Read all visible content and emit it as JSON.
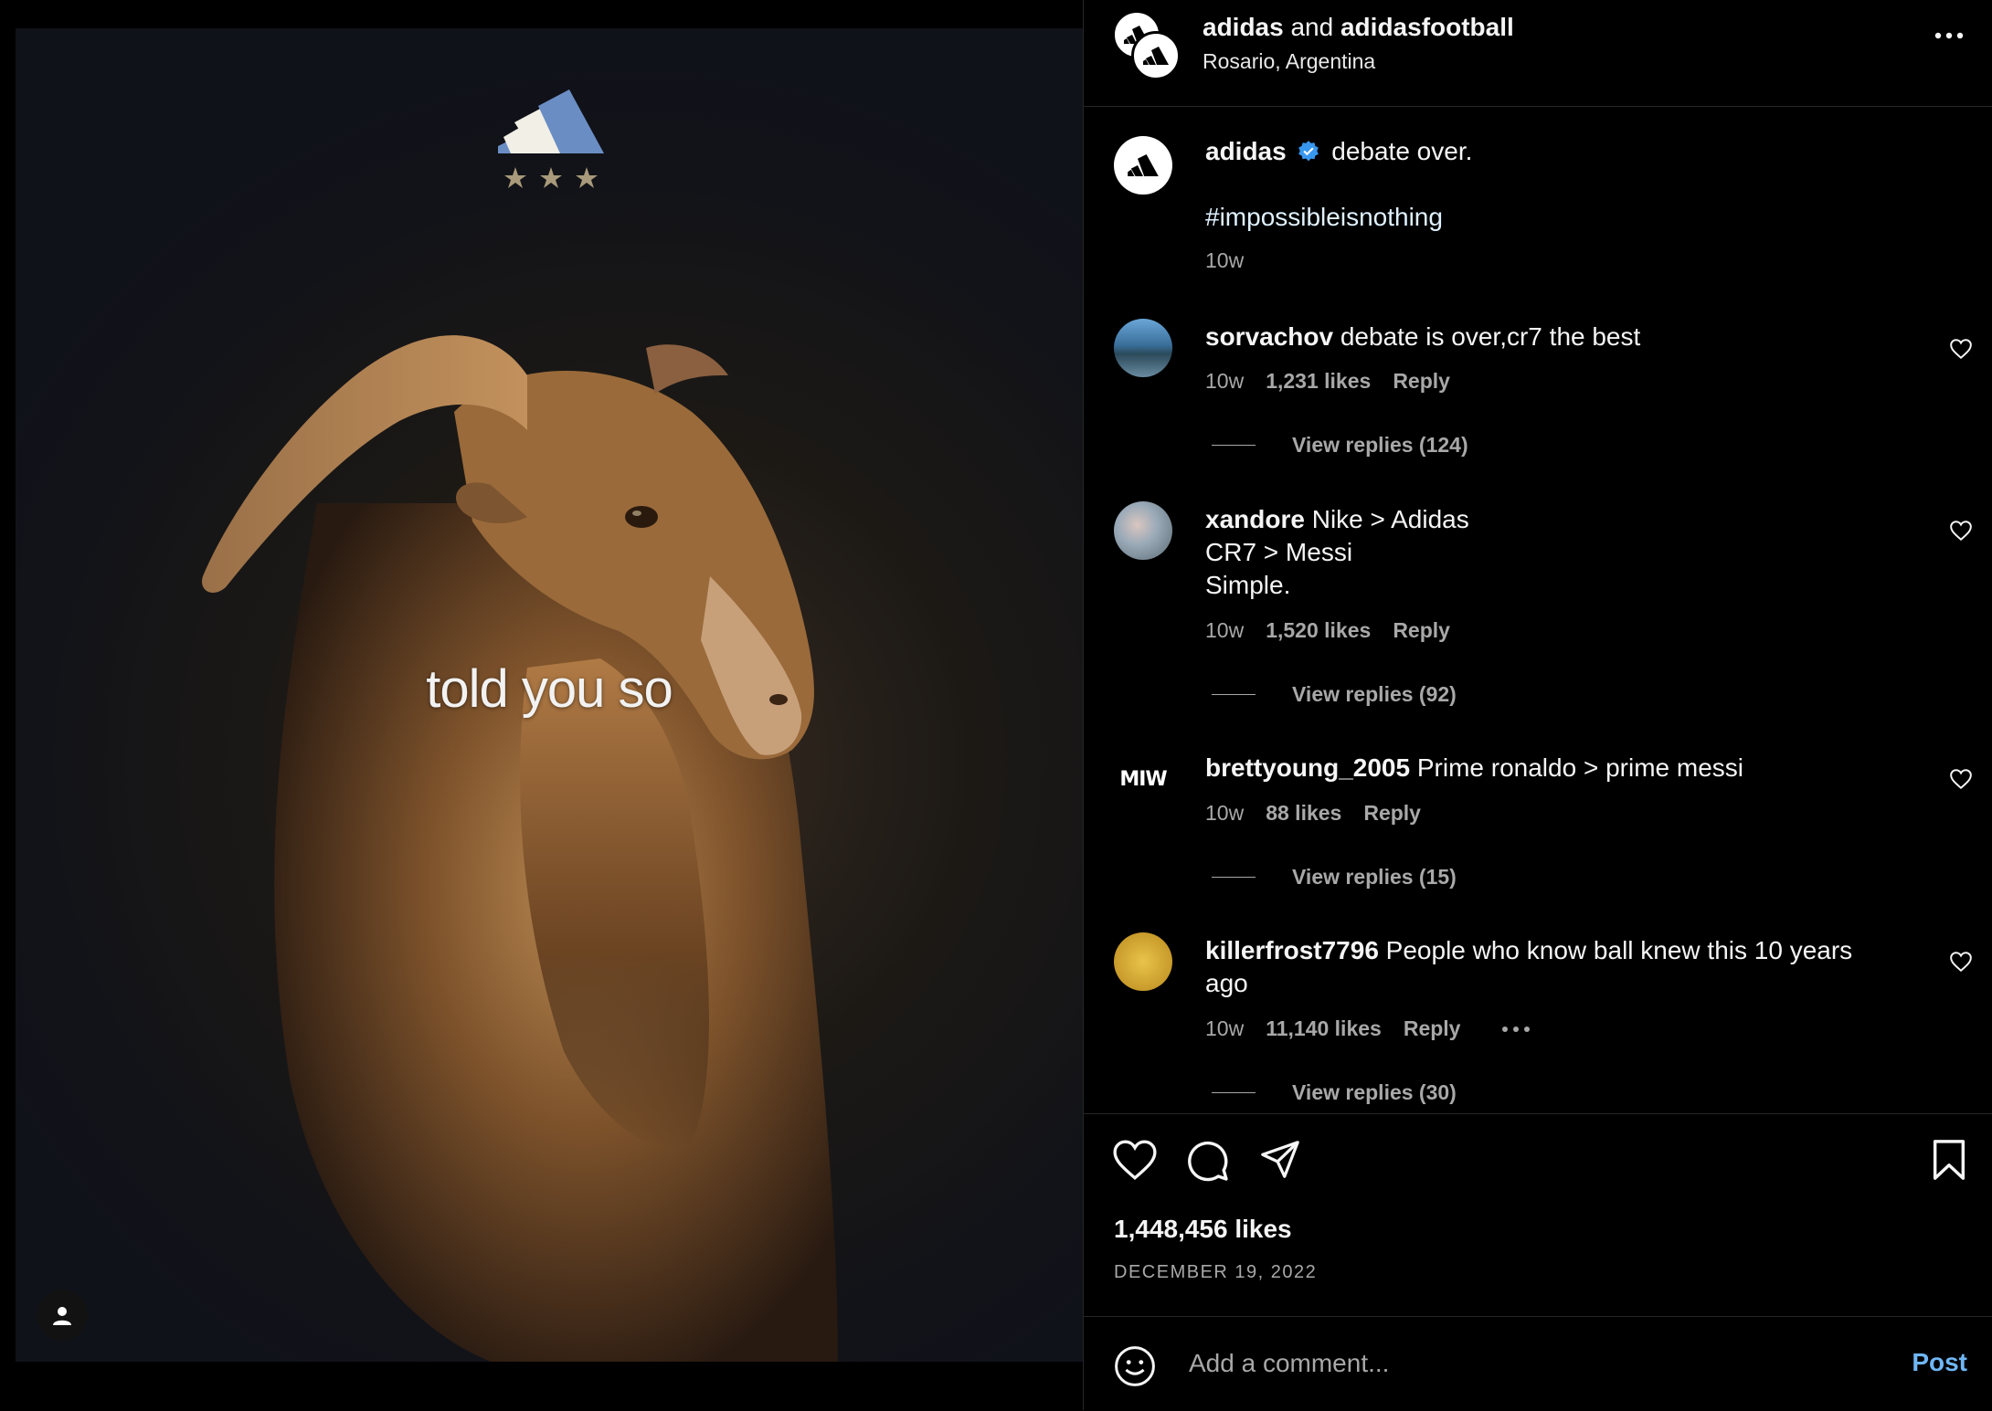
{
  "media": {
    "overlay_text": "told you so",
    "icons": {
      "brand_logo": "adidas-three-stripes-logo",
      "stars": "three-stars-icon",
      "user_tag": "user-tag-icon"
    }
  },
  "header": {
    "account1": "adidas",
    "joiner": " and ",
    "account2": "adidasfootball",
    "location": "Rosario, Argentina",
    "more_icon": "more-options-icon"
  },
  "caption": {
    "user": "adidas",
    "verified_icon": "verified-badge-icon",
    "text": "debate over.",
    "hashtag": "#impossibleisnothing",
    "time": "10w"
  },
  "comments": [
    {
      "user": "sorvachov",
      "text": "debate is over,cr7 the best",
      "time": "10w",
      "likes": "1,231 likes",
      "reply": "Reply",
      "view_replies": "View replies (124)"
    },
    {
      "user": "xandore",
      "text_lines": [
        "Nike > Adidas",
        "CR7 > Messi",
        "Simple."
      ],
      "time": "10w",
      "likes": "1,520 likes",
      "reply": "Reply",
      "view_replies": "View replies (92)"
    },
    {
      "user": "brettyoung_2005",
      "text": "Prime ronaldo > prime messi",
      "time": "10w",
      "likes": "88 likes",
      "reply": "Reply",
      "view_replies": "View replies (15)",
      "avatar_text": "MIW"
    },
    {
      "user": "killerfrost7796",
      "text": "People who know ball knew this 10 years ago",
      "time": "10w",
      "likes": "11,140 likes",
      "reply": "Reply",
      "view_replies": "View replies (30)"
    }
  ],
  "actions": {
    "likes": "1,448,456 likes",
    "date": "DECEMBER 19, 2022",
    "icons": [
      "heart-icon",
      "comment-icon",
      "share-icon",
      "bookmark-icon"
    ]
  },
  "add_comment": {
    "placeholder": "Add a comment...",
    "post_label": "Post",
    "emoji_icon": "emoji-icon"
  },
  "colors": {
    "background": "#000000",
    "text": "#f5f5f5",
    "muted": "#a8a8a8",
    "link": "#6fb6f5",
    "verified": "#3897f0",
    "divider": "#262626"
  }
}
